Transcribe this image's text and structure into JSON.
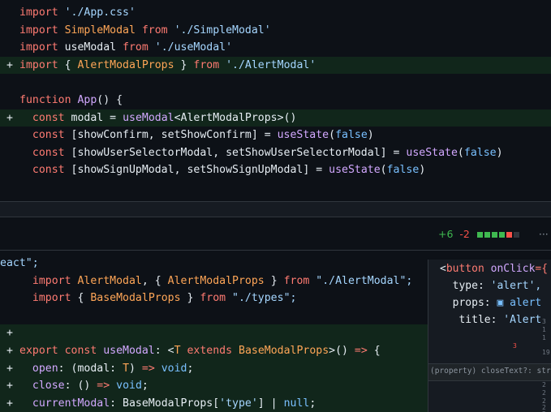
{
  "diff": {
    "top_lines": [
      {
        "added": false,
        "segments": [
          [
            "k",
            "import "
          ],
          [
            "s",
            "'./App.css'"
          ]
        ]
      },
      {
        "added": false,
        "segments": [
          [
            "k",
            "import "
          ],
          [
            "t",
            "SimpleModal "
          ],
          [
            "k",
            "from "
          ],
          [
            "s",
            "'./SimpleModal'"
          ]
        ]
      },
      {
        "added": false,
        "segments": [
          [
            "k",
            "import "
          ],
          [
            "p",
            "useModal "
          ],
          [
            "k",
            "from "
          ],
          [
            "s",
            "'./useModal'"
          ]
        ]
      },
      {
        "added": true,
        "segments": [
          [
            "k",
            "import "
          ],
          [
            "p",
            "{ "
          ],
          [
            "t",
            "AlertModalProps "
          ],
          [
            "p",
            "} "
          ],
          [
            "k",
            "from "
          ],
          [
            "s",
            "'./AlertModal'"
          ]
        ]
      },
      {
        "added": false,
        "segments": []
      },
      {
        "added": false,
        "segments": [
          [
            "k",
            "function "
          ],
          [
            "f",
            "App"
          ],
          [
            "p",
            "() {"
          ]
        ]
      },
      {
        "added": true,
        "segments": [
          [
            "p",
            "  "
          ],
          [
            "k",
            "const "
          ],
          [
            "p",
            "modal = "
          ],
          [
            "f",
            "useModal"
          ],
          [
            "p",
            "<AlertModalProps>()"
          ]
        ]
      },
      {
        "added": false,
        "segments": [
          [
            "p",
            "  "
          ],
          [
            "k",
            "const "
          ],
          [
            "p",
            "[showConfirm, setShowConfirm] = "
          ],
          [
            "f",
            "useState"
          ],
          [
            "p",
            "("
          ],
          [
            "c",
            "false"
          ],
          [
            "p",
            ")"
          ]
        ]
      },
      {
        "added": false,
        "segments": [
          [
            "p",
            "  "
          ],
          [
            "k",
            "const "
          ],
          [
            "p",
            "[showUserSelectorModal, setShowUserSelectorModal] = "
          ],
          [
            "f",
            "useState"
          ],
          [
            "p",
            "("
          ],
          [
            "c",
            "false"
          ],
          [
            "p",
            ")"
          ]
        ]
      },
      {
        "added": false,
        "segments": [
          [
            "p",
            "  "
          ],
          [
            "k",
            "const "
          ],
          [
            "p",
            "[showSignUpModal, setShowSignUpModal] = "
          ],
          [
            "f",
            "useState"
          ],
          [
            "p",
            "("
          ],
          [
            "c",
            "false"
          ],
          [
            "p",
            ")"
          ]
        ]
      }
    ],
    "stats": {
      "added": "+6",
      "removed": "-2",
      "more": "···"
    },
    "bottom_lines": [
      {
        "added": false,
        "mark": "",
        "segments": [
          [
            "s",
            "eact\";"
          ]
        ]
      },
      {
        "added": false,
        "mark": "",
        "segments": [
          [
            "k",
            "  import "
          ],
          [
            "t",
            "AlertModal"
          ],
          [
            "p",
            ", { "
          ],
          [
            "t",
            "AlertModalProps "
          ],
          [
            "p",
            "} "
          ],
          [
            "k",
            "from "
          ],
          [
            "s",
            "\"./AlertModal\";"
          ]
        ]
      },
      {
        "added": false,
        "mark": "",
        "segments": [
          [
            "k",
            "  import "
          ],
          [
            "p",
            "{ "
          ],
          [
            "t",
            "BaseModalProps "
          ],
          [
            "p",
            "} "
          ],
          [
            "k",
            "from "
          ],
          [
            "s",
            "\"./types\";"
          ]
        ]
      },
      {
        "added": false,
        "mark": "",
        "segments": []
      },
      {
        "added": true,
        "mark": "+",
        "segments": []
      },
      {
        "added": true,
        "mark": "+",
        "segments": [
          [
            "k",
            "export const "
          ],
          [
            "f",
            "useModal"
          ],
          [
            "p",
            ": <"
          ],
          [
            "t",
            "T "
          ],
          [
            "k",
            "extends "
          ],
          [
            "t",
            "BaseModalProps"
          ],
          [
            "p",
            ">() "
          ],
          [
            "k",
            "=> "
          ],
          [
            "p",
            "{"
          ]
        ]
      },
      {
        "added": true,
        "mark": "+",
        "segments": [
          [
            "p",
            "  "
          ],
          [
            "f",
            "open"
          ],
          [
            "p",
            ": (modal: "
          ],
          [
            "t",
            "T"
          ],
          [
            "p",
            ") "
          ],
          [
            "k",
            "=> "
          ],
          [
            "c",
            "void"
          ],
          [
            "p",
            ";"
          ]
        ]
      },
      {
        "added": true,
        "mark": "+",
        "segments": [
          [
            "p",
            "  "
          ],
          [
            "f",
            "close"
          ],
          [
            "p",
            ": () "
          ],
          [
            "k",
            "=> "
          ],
          [
            "c",
            "void"
          ],
          [
            "p",
            ";"
          ]
        ]
      },
      {
        "added": true,
        "mark": "+",
        "segments": [
          [
            "p",
            "  "
          ],
          [
            "f",
            "currentModal"
          ],
          [
            "p",
            ": BaseModalProps["
          ],
          [
            "s",
            "'type'"
          ],
          [
            "p",
            "] | "
          ],
          [
            "c",
            "null"
          ],
          [
            "p",
            ";"
          ]
        ]
      }
    ]
  },
  "overlay": {
    "lines": [
      {
        "segments": [
          [
            "p",
            "<"
          ],
          [
            "k",
            "button "
          ],
          [
            "f",
            "onClick"
          ],
          [
            "k",
            "={"
          ]
        ]
      },
      {
        "segments": [
          [
            "p",
            "  type: "
          ],
          [
            "s",
            "'alert',"
          ]
        ]
      },
      {
        "segments": [
          [
            "p",
            "  props: "
          ],
          [
            "c",
            "▣ alert"
          ]
        ]
      },
      {
        "segments": [
          [
            "p",
            "   title: "
          ],
          [
            "s",
            "'Alert"
          ]
        ]
      }
    ],
    "tooltip": "(property) closeText?: strin",
    "minimap_numbers": [
      "3",
      "1",
      "1",
      "19",
      "2",
      "2",
      "2",
      "2",
      "2"
    ],
    "gutter_number": "3"
  },
  "colors": {
    "added_bg": "#11261b",
    "bg": "#0d1117",
    "added_text": "#3fb950",
    "removed_text": "#f85149"
  }
}
